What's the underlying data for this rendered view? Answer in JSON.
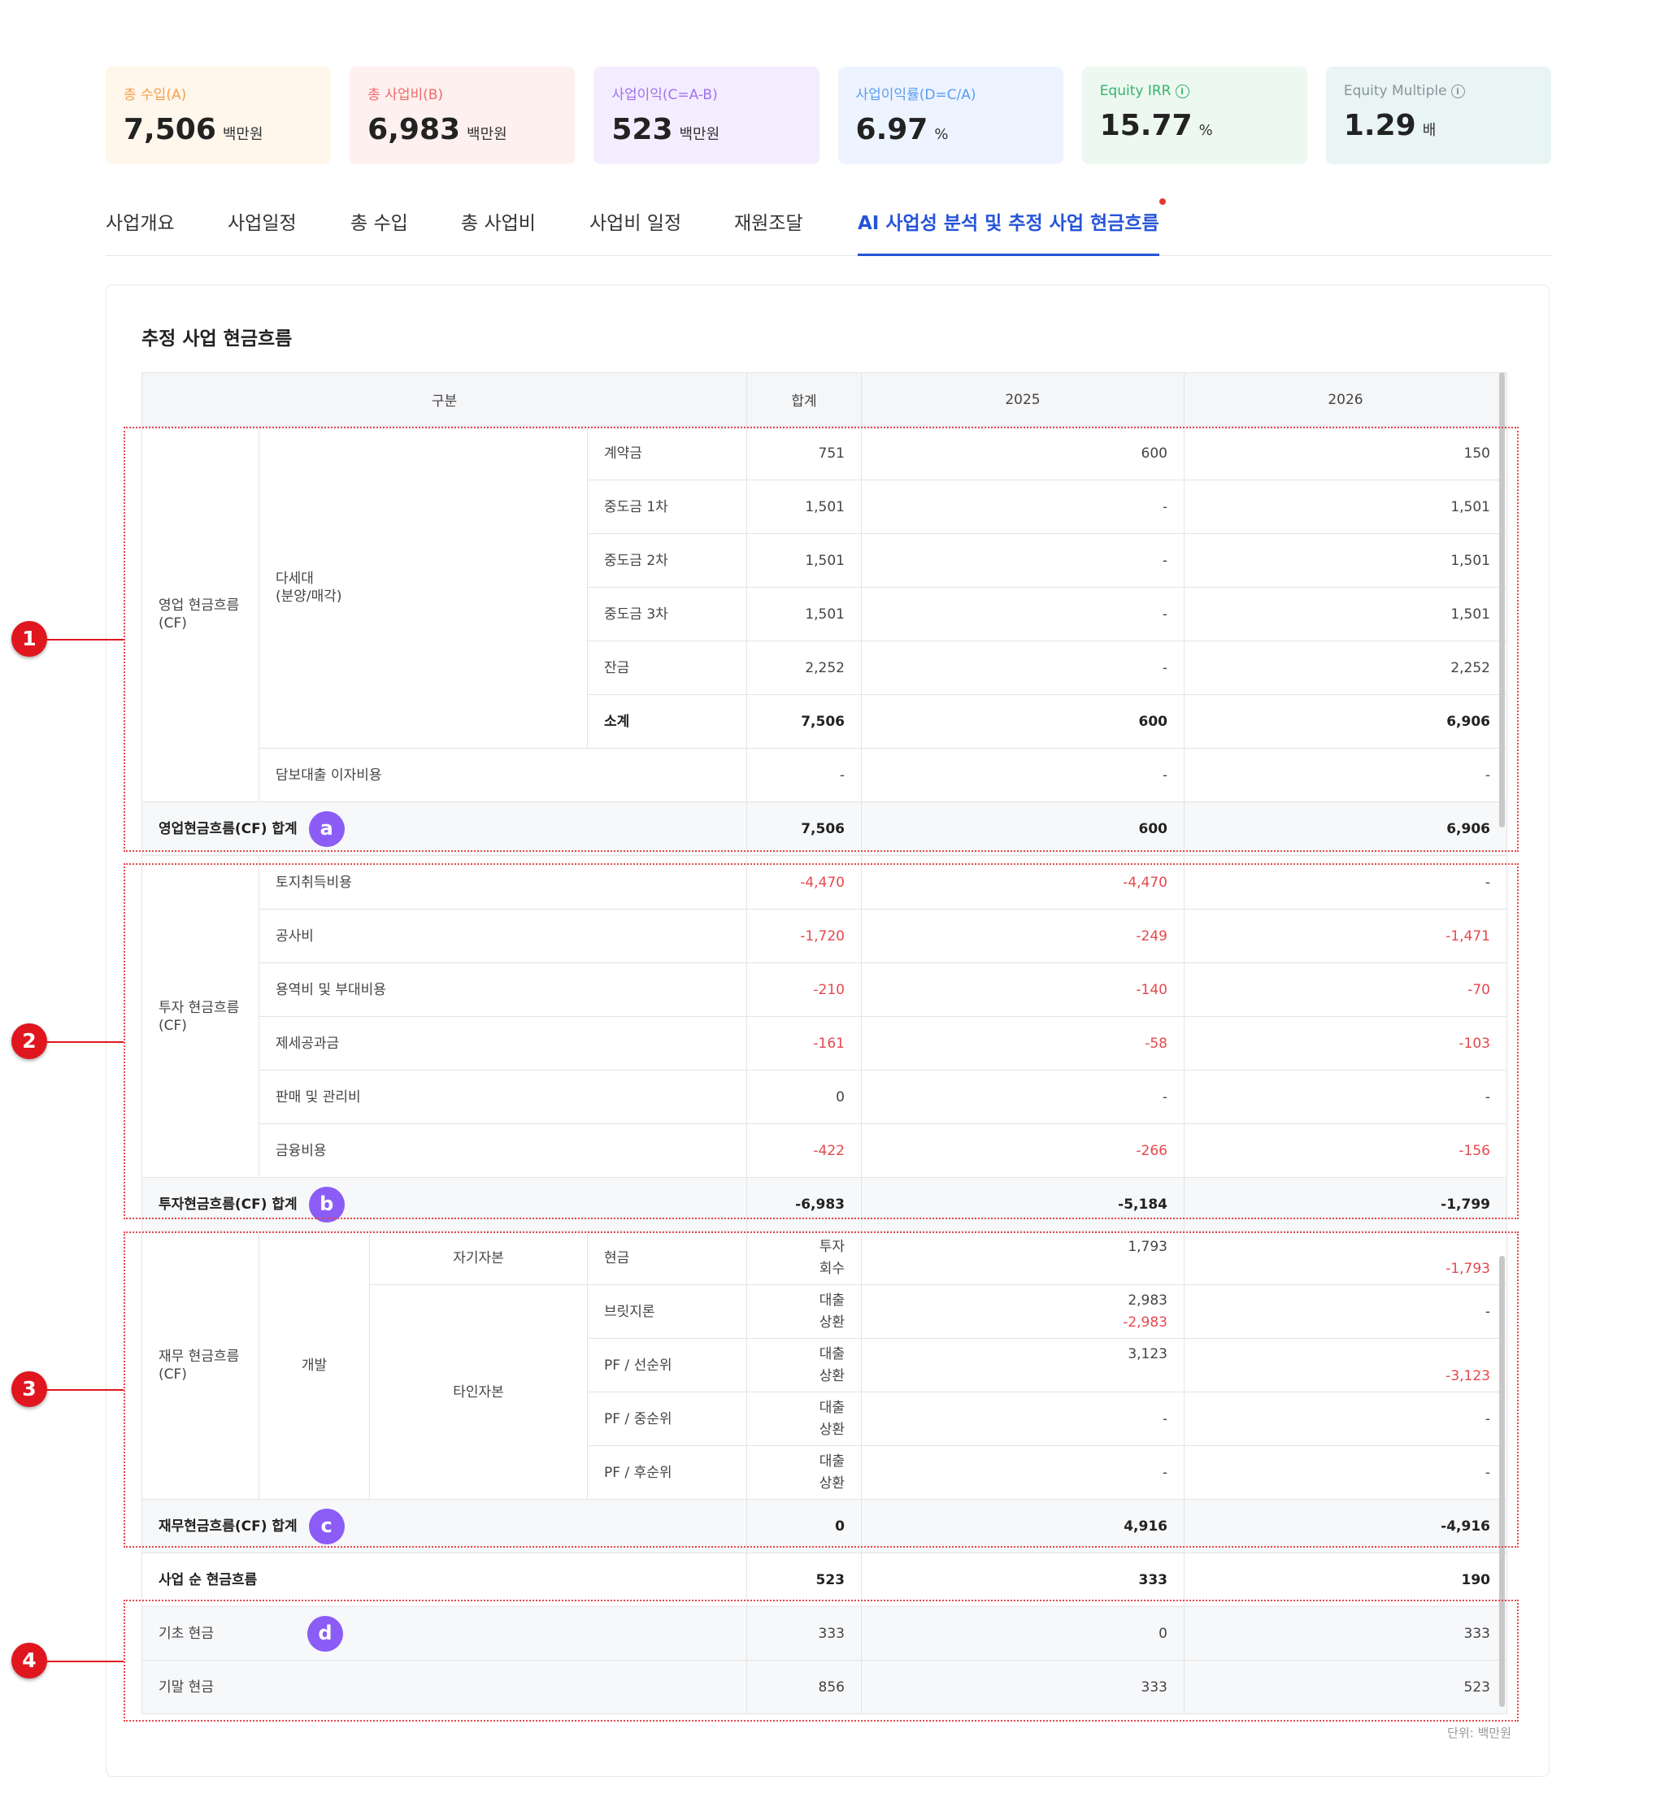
{
  "kpis": [
    {
      "label": "총 수입(A)",
      "value": "7,506",
      "unit": "백만원",
      "bg": "#fff6ec",
      "color": "#f5a04b",
      "info": false
    },
    {
      "label": "총 사업비(B)",
      "value": "6,983",
      "unit": "백만원",
      "bg": "#fff0f0",
      "color": "#f06a6a",
      "info": false
    },
    {
      "label": "사업이익(C=A-B)",
      "value": "523",
      "unit": "백만원",
      "bg": "#f4edff",
      "color": "#a070f0",
      "info": false
    },
    {
      "label": "사업이익률(D=C/A)",
      "value": "6.97",
      "unit": "%",
      "bg": "#edf4ff",
      "color": "#5b9cf2",
      "info": false
    },
    {
      "label": "Equity IRR",
      "value": "15.77",
      "unit": "%",
      "bg": "#edf8f1",
      "color": "#34b46a",
      "info": true
    },
    {
      "label": "Equity Multiple",
      "value": "1.29",
      "unit": "배",
      "bg": "#e8f5f4",
      "color": "#8a9499",
      "info": true
    }
  ],
  "tabs": [
    "사업개요",
    "사업일정",
    "총 수입",
    "총 사업비",
    "사업비 일정",
    "재원조달",
    "AI 사업성 분석 및 추정 사업 현금흐름"
  ],
  "active_tab": 6,
  "panel_title": "추정 사업 현금흐름",
  "unit_note": "단위: 백만원",
  "table": {
    "headers": {
      "category": "구분",
      "total": "합계",
      "y1": "2025",
      "y2": "2026"
    },
    "operating": {
      "group": "영업 현금흐름\n(CF)",
      "sub": "다세대\n(분양/매각)",
      "rows": [
        {
          "label": "계약금",
          "total": "751",
          "y1": "600",
          "y2": "150"
        },
        {
          "label": "중도금 1차",
          "total": "1,501",
          "y1": "-",
          "y2": "1,501"
        },
        {
          "label": "중도금 2차",
          "total": "1,501",
          "y1": "-",
          "y2": "1,501"
        },
        {
          "label": "중도금 3차",
          "total": "1,501",
          "y1": "-",
          "y2": "1,501"
        },
        {
          "label": "잔금",
          "total": "2,252",
          "y1": "-",
          "y2": "2,252"
        },
        {
          "label": "소계",
          "total": "7,506",
          "y1": "600",
          "y2": "6,906"
        }
      ],
      "interest": {
        "label": "담보대출 이자비용",
        "total": "-",
        "y1": "-",
        "y2": "-"
      },
      "sum": {
        "label": "영업현금흐름(CF) 합계",
        "badge": "a",
        "total": "7,506",
        "y1": "600",
        "y2": "6,906"
      }
    },
    "investing": {
      "group": "투자 현금흐름\n(CF)",
      "rows": [
        {
          "label": "토지취득비용",
          "total": "-4,470",
          "y1": "-4,470",
          "y2": "-"
        },
        {
          "label": "공사비",
          "total": "-1,720",
          "y1": "-249",
          "y2": "-1,471"
        },
        {
          "label": "용역비 및 부대비용",
          "total": "-210",
          "y1": "-140",
          "y2": "-70"
        },
        {
          "label": "제세공과금",
          "total": "-161",
          "y1": "-58",
          "y2": "-103"
        },
        {
          "label": "판매 및 관리비",
          "total": "0",
          "y1": "-",
          "y2": "-"
        },
        {
          "label": "금융비용",
          "total": "-422",
          "y1": "-266",
          "y2": "-156"
        }
      ],
      "sum": {
        "label": "투자현금흐름(CF) 합계",
        "badge": "b",
        "total": "-6,983",
        "y1": "-5,184",
        "y2": "-1,799"
      }
    },
    "financing": {
      "group": "재무 현금흐름\n(CF)",
      "sub": "개발",
      "equity": "자기자본",
      "debt": "타인자본",
      "rows": [
        {
          "label": "현금",
          "kind_a": "투자",
          "kind_b": "회수",
          "y1_a": "1,793",
          "y1_b": "",
          "y2_a": "",
          "y2_b": "-1,793"
        },
        {
          "label": "브릿지론",
          "kind_a": "대출",
          "kind_b": "상환",
          "y1_a": "2,983",
          "y1_b": "-2,983",
          "y2_a": "-",
          "y2_b": ""
        },
        {
          "label": "PF / 선순위",
          "kind_a": "대출",
          "kind_b": "상환",
          "y1_a": "3,123",
          "y1_b": "",
          "y2_a": "",
          "y2_b": "-3,123"
        },
        {
          "label": "PF / 중순위",
          "kind_a": "대출",
          "kind_b": "상환",
          "y1_a": "-",
          "y1_b": "",
          "y2_a": "-",
          "y2_b": ""
        },
        {
          "label": "PF / 후순위",
          "kind_a": "대출",
          "kind_b": "상환",
          "y1_a": "-",
          "y1_b": "",
          "y2_a": "-",
          "y2_b": ""
        }
      ],
      "sum": {
        "label": "재무현금흐름(CF) 합계",
        "badge": "c",
        "total": "0",
        "y1": "4,916",
        "y2": "-4,916"
      }
    },
    "net": {
      "label": "사업 순 현금흐름",
      "total": "523",
      "y1": "333",
      "y2": "190"
    },
    "cash": {
      "badge": "d",
      "beginning": {
        "label": "기초 현금",
        "total": "333",
        "y1": "0",
        "y2": "333"
      },
      "ending": {
        "label": "기말 현금",
        "total": "856",
        "y1": "333",
        "y2": "523"
      }
    }
  },
  "markers": [
    "1",
    "2",
    "3",
    "4"
  ]
}
